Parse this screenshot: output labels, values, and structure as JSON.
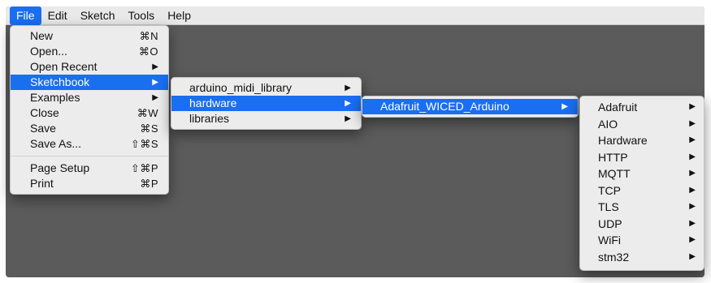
{
  "menubar": {
    "items": [
      "File",
      "Edit",
      "Sketch",
      "Tools",
      "Help"
    ]
  },
  "file_menu": {
    "items": [
      {
        "label": "New",
        "shortcut": "⌘N"
      },
      {
        "label": "Open...",
        "shortcut": "⌘O"
      },
      {
        "label": "Open Recent",
        "arrow": "▶"
      },
      {
        "label": "Sketchbook",
        "arrow": "▶"
      },
      {
        "label": "Examples",
        "arrow": "▶"
      },
      {
        "label": "Close",
        "shortcut": "⌘W"
      },
      {
        "label": "Save",
        "shortcut": "⌘S"
      },
      {
        "label": "Save As...",
        "shortcut": "⇧⌘S"
      },
      {
        "label": "Page Setup",
        "shortcut": "⇧⌘P"
      },
      {
        "label": "Print",
        "shortcut": "⌘P"
      }
    ]
  },
  "sketchbook_menu": {
    "items": [
      {
        "label": "arduino_midi_library",
        "arrow": "▶"
      },
      {
        "label": "hardware",
        "arrow": "▶"
      },
      {
        "label": "libraries",
        "arrow": "▶"
      }
    ]
  },
  "hardware_menu": {
    "items": [
      {
        "label": "Adafruit_WICED_Arduino",
        "arrow": "▶"
      }
    ]
  },
  "adafruit_menu": {
    "items": [
      {
        "label": "Adafruit",
        "arrow": "▶"
      },
      {
        "label": "AIO",
        "arrow": "▶"
      },
      {
        "label": "Hardware",
        "arrow": "▶"
      },
      {
        "label": "HTTP",
        "arrow": "▶"
      },
      {
        "label": "MQTT",
        "arrow": "▶"
      },
      {
        "label": "TCP",
        "arrow": "▶"
      },
      {
        "label": "TLS",
        "arrow": "▶"
      },
      {
        "label": "UDP",
        "arrow": "▶"
      },
      {
        "label": "WiFi",
        "arrow": "▶"
      },
      {
        "label": "stm32",
        "arrow": "▶"
      }
    ]
  },
  "colors": {
    "highlight": "#1a6ef0",
    "menu_bg": "#ececec",
    "desktop_bg": "#5b5b5b"
  }
}
